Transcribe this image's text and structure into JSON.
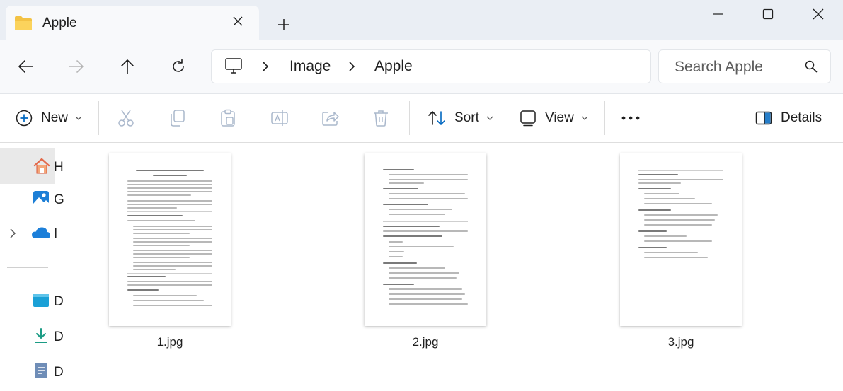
{
  "window": {
    "tab_title": "Apple",
    "colors": {
      "accent": "#0067c0",
      "folder": "#f3c244",
      "titlebar": "#eaeef4"
    }
  },
  "address": {
    "crumbs": [
      "Image",
      "Apple"
    ]
  },
  "search": {
    "placeholder": "Search Apple"
  },
  "toolbar": {
    "new_label": "New",
    "sort_label": "Sort",
    "view_label": "View",
    "details_label": "Details"
  },
  "sidebar": {
    "items": [
      {
        "icon": "home-icon",
        "label": "H"
      },
      {
        "icon": "gallery-icon",
        "label": "G"
      },
      {
        "icon": "onedrive-cloud-icon",
        "label": "I"
      },
      {
        "icon": "desktop-icon",
        "label": "D"
      },
      {
        "icon": "downloads-icon",
        "label": "D"
      },
      {
        "icon": "documents-icon",
        "label": "D"
      }
    ]
  },
  "files": [
    {
      "name": "1.jpg"
    },
    {
      "name": "2.jpg"
    },
    {
      "name": "3.jpg"
    }
  ]
}
